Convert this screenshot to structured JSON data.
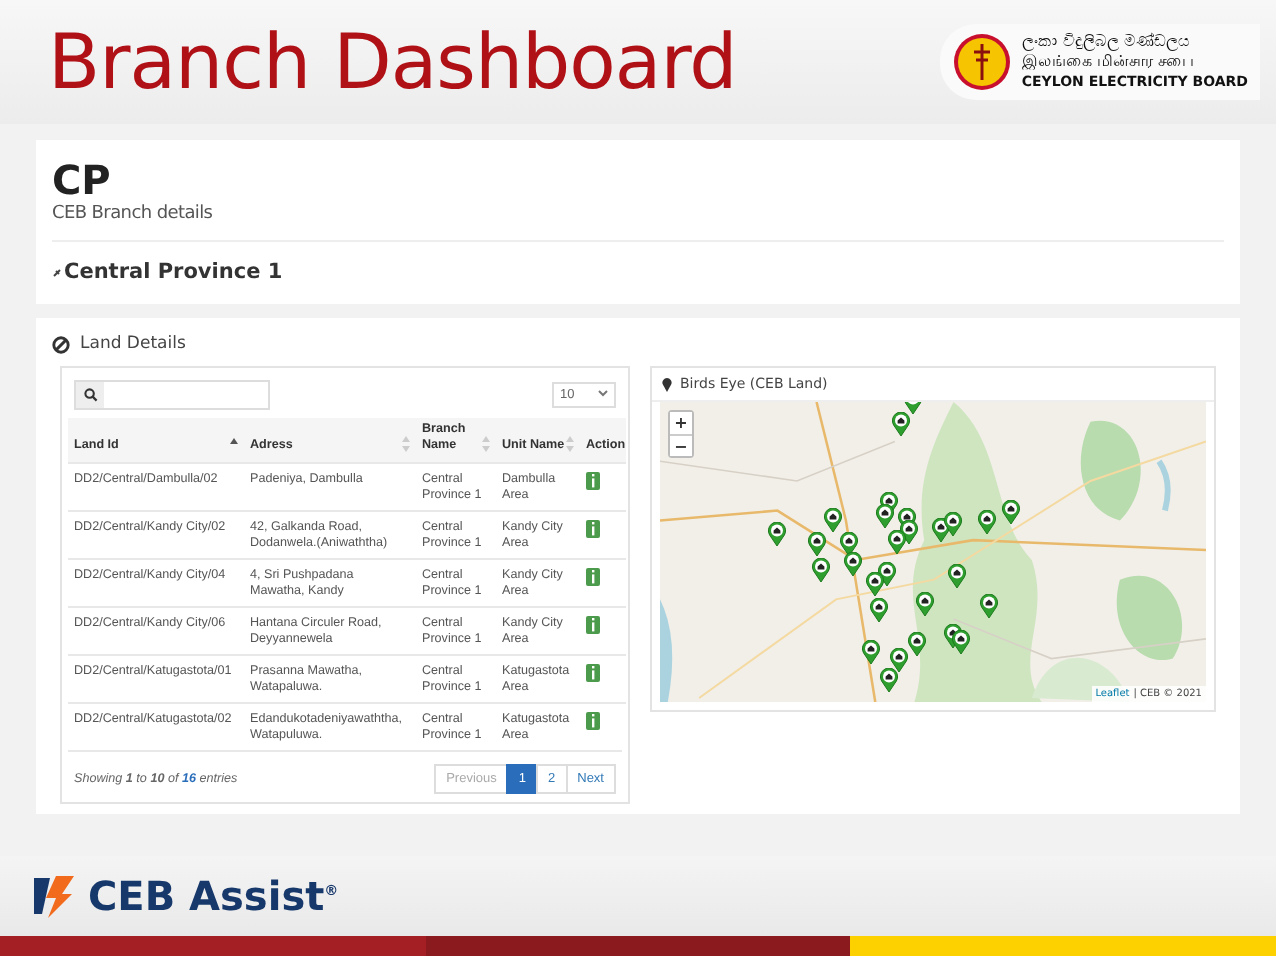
{
  "slide": {
    "title": "Branch Dashboard",
    "logo_lines": [
      "ලංකා විදුලිබල මණ්ඩලය",
      "இலங்கை மின்சார சபை",
      "CEYLON ELECTRICITY BOARD"
    ]
  },
  "page": {
    "title": "CP",
    "subtitle": "CEB Branch details",
    "branch": "Central Province 1"
  },
  "land_details": {
    "title": "Land Details",
    "page_size": "10",
    "table": {
      "columns": [
        {
          "label": "Land Id",
          "sortable": true,
          "sorted": true
        },
        {
          "label": "Adress",
          "sortable": true,
          "sorted": false
        },
        {
          "label": "Branch Name",
          "sortable": true,
          "sorted": false
        },
        {
          "label": "Unit Name",
          "sortable": true,
          "sorted": false
        },
        {
          "label": "Action",
          "sortable": false,
          "sorted": false
        }
      ],
      "rows": [
        [
          "DD2/Central/Dambulla/02",
          "Padeniya, Dambulla",
          "Central Province 1",
          "Dambulla Area"
        ],
        [
          "DD2/Central/Kandy City/02",
          "42, Galkanda Road, Dodanwela.(Aniwaththa)",
          "Central Province 1",
          "Kandy City Area"
        ],
        [
          "DD2/Central/Kandy City/04",
          "4, Sri Pushpadana Mawatha, Kandy",
          "Central Province 1",
          "Kandy City Area"
        ],
        [
          "DD2/Central/Kandy City/06",
          "Hantana Circuler Road, Deyyannewela",
          "Central Province 1",
          "Kandy City Area"
        ],
        [
          "DD2/Central/Katugastota/01",
          "Prasanna Mawatha, Watapaluwa.",
          "Central Province 1",
          "Katugastota Area"
        ],
        [
          "DD2/Central/Katugastota/02",
          "Edandukotadeniyawaththa, Watapuluwa.",
          "Central Province 1",
          "Katugastota Area"
        ]
      ]
    },
    "info": "Showing **1** to **10** of **16** entries",
    "pagination": [
      {
        "label": "Previous",
        "selected": false,
        "disabled": true
      },
      {
        "label": "1",
        "selected": true,
        "disabled": false
      },
      {
        "label": "2",
        "selected": false,
        "disabled": false
      },
      {
        "label": "Next",
        "selected": false,
        "disabled": false
      }
    ]
  },
  "map": {
    "title": "Birds Eye (CEB Land)",
    "zoom_in": "+",
    "zoom_out": "−",
    "attribution_link": "Leaflet",
    "attribution": "| CEB © 2021"
  },
  "footer": {
    "brand": "CEB Assist$^{®}$"
  }
}
